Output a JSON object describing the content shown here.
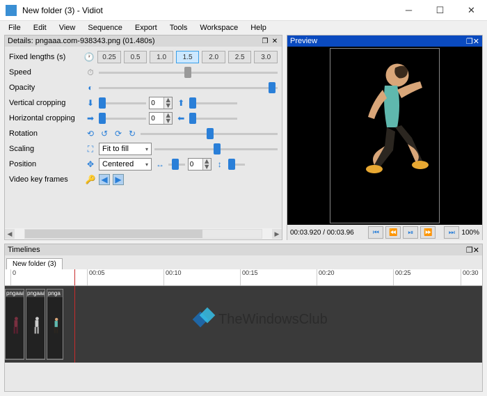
{
  "window": {
    "title": "New folder (3) - Vidiot"
  },
  "menu": [
    "File",
    "Edit",
    "View",
    "Sequence",
    "Export",
    "Tools",
    "Workspace",
    "Help"
  ],
  "details": {
    "title": "Details: pngaaa.com-938343.png (01.480s)",
    "rows": {
      "fixedLengths": "Fixed lengths (s)",
      "speed": "Speed",
      "opacity": "Opacity",
      "verticalCropping": "Vertical cropping",
      "horizontalCropping": "Horizontal cropping",
      "rotation": "Rotation",
      "scaling": "Scaling",
      "position": "Position",
      "videoKeyFrames": "Video key frames"
    },
    "lengthOptions": [
      "0.25",
      "0.5",
      "1.0",
      "1.5",
      "2.0",
      "2.5",
      "3.0"
    ],
    "lengthSelected": "1.5",
    "vCropValue": "0",
    "hCropValue": "0",
    "posValue": "0",
    "scalingMode": "Fit to fill",
    "positionMode": "Centered"
  },
  "preview": {
    "title": "Preview",
    "time": "00:03.920 / 00:03.96",
    "zoom": "100%"
  },
  "timelines": {
    "title": "Timelines",
    "tab": "New folder (3)",
    "ticks": [
      "0",
      "00:05",
      "00:10",
      "00:15",
      "00:20",
      "00:25",
      "00:30"
    ],
    "clipLabels": [
      "pngaaa",
      "pngaaa",
      "pnga"
    ]
  },
  "watermark": "TheWindowsClub"
}
